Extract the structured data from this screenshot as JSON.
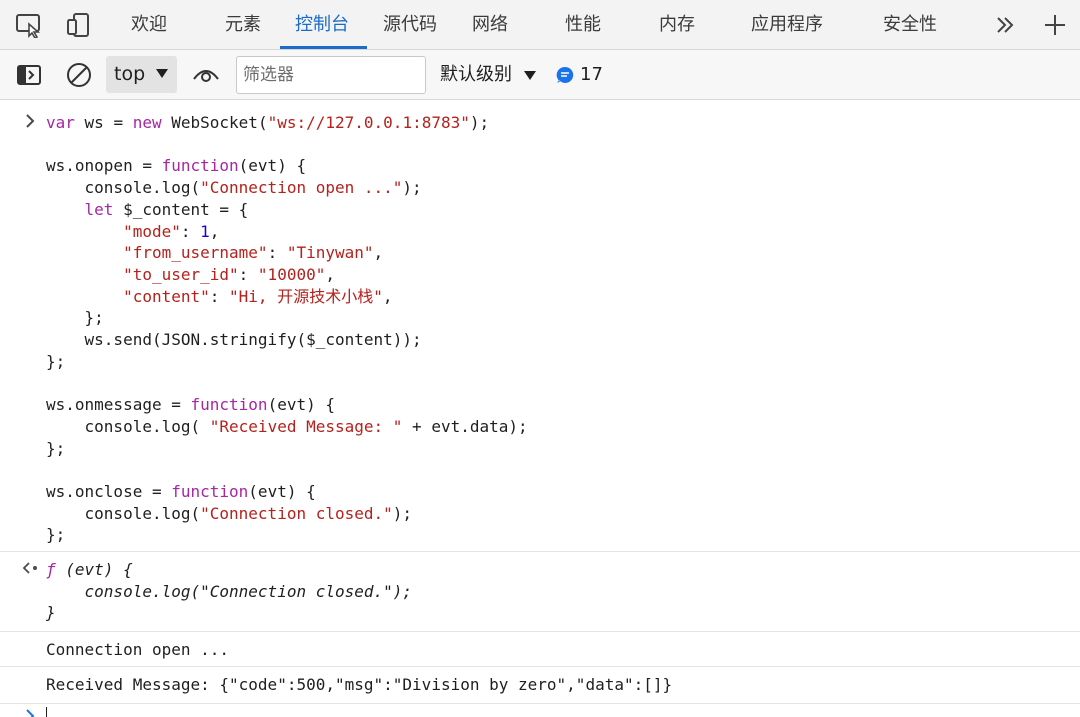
{
  "tabs": [
    {
      "label": "欢迎",
      "active": false
    },
    {
      "label": "元素",
      "active": false
    },
    {
      "label": "控制台",
      "active": true
    },
    {
      "label": "源代码",
      "active": false
    },
    {
      "label": "网络",
      "active": false
    },
    {
      "label": "性能",
      "active": false
    },
    {
      "label": "内存",
      "active": false
    },
    {
      "label": "应用程序",
      "active": false
    },
    {
      "label": "安全性",
      "active": false
    }
  ],
  "toolbar": {
    "context": "top",
    "filter_placeholder": "筛选器",
    "level": "默认级别",
    "issue_count": "17"
  },
  "input_code": {
    "l1_a": "var",
    "l1_b": " ws = ",
    "l1_c": "new",
    "l1_d": " WebSocket(",
    "l1_e": "\"ws://127.0.0.1:8783\"",
    "l1_f": ");",
    "l3_a": "ws.onopen = ",
    "l3_b": "function",
    "l3_c": "(evt) {",
    "l4_a": "    console.log(",
    "l4_b": "\"Connection open ...\"",
    "l4_c": ");",
    "l5_a": "    ",
    "l5_b": "let",
    "l5_c": " $_content = {",
    "l6_a": "        ",
    "l6_b": "\"mode\"",
    "l6_c": ": ",
    "l6_d": "1",
    "l6_e": ",",
    "l7_a": "        ",
    "l7_b": "\"from_username\"",
    "l7_c": ": ",
    "l7_d": "\"Tinywan\"",
    "l7_e": ",",
    "l8_a": "        ",
    "l8_b": "\"to_user_id\"",
    "l8_c": ": ",
    "l8_d": "\"10000\"",
    "l8_e": ",",
    "l9_a": "        ",
    "l9_b": "\"content\"",
    "l9_c": ": ",
    "l9_d": "\"Hi, 开源技术小栈\"",
    "l9_e": ",",
    "l10": "    };",
    "l11": "    ws.send(JSON.stringify($_content));",
    "l12": "};",
    "l14_a": "ws.onmessage = ",
    "l14_b": "function",
    "l14_c": "(evt) {",
    "l15_a": "    console.log( ",
    "l15_b": "\"Received Message: \"",
    "l15_c": " + evt.data);",
    "l16": "};",
    "l18_a": "ws.onclose = ",
    "l18_b": "function",
    "l18_c": "(evt) {",
    "l19_a": "    console.log(",
    "l19_b": "\"Connection closed.\"",
    "l19_c": ");",
    "l20": "};"
  },
  "return_value": {
    "l1_a": "ƒ",
    "l1_b": " (evt) {",
    "l2": "    console.log(\"Connection closed.\");",
    "l3": "}"
  },
  "logs": [
    "Connection open ...",
    "Received Message: {\"code\":500,\"msg\":\"Division by zero\",\"data\":[]}"
  ]
}
